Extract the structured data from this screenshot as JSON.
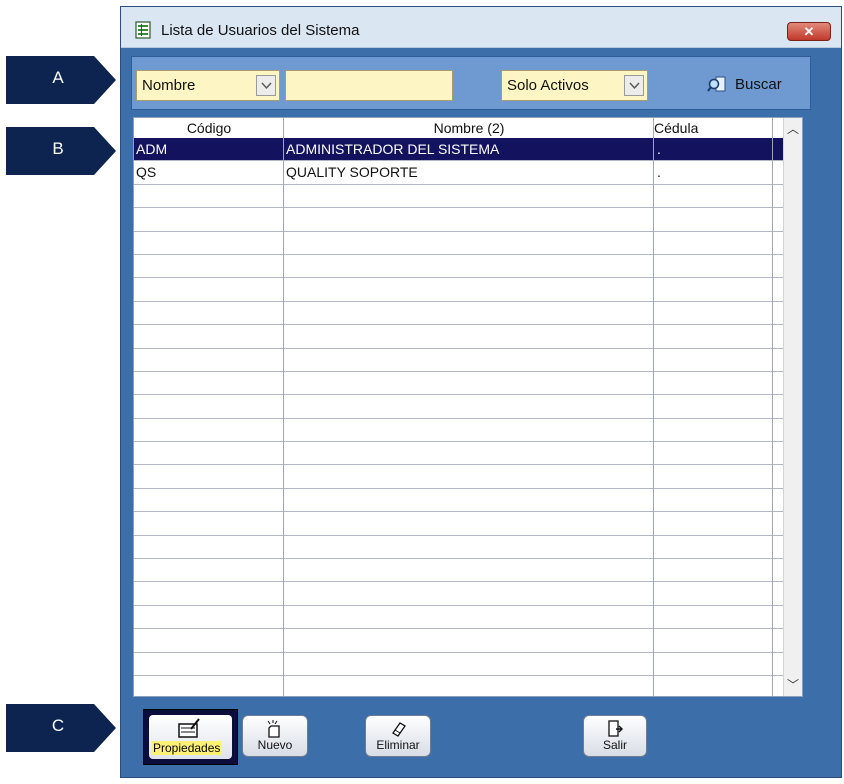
{
  "window": {
    "title": "Lista de Usuarios del Sistema",
    "close_label": "✕",
    "title_icon": "document-grid-icon"
  },
  "filter": {
    "field_select": "Nombre",
    "search_value": "",
    "status_select": "Solo Activos",
    "search_button": "Buscar",
    "search_icon": "magnifier-icon"
  },
  "grid": {
    "columns": [
      "Código",
      "Nombre (2)",
      "Cédula"
    ],
    "rows": [
      {
        "codigo": "ADM",
        "nombre": "ADMINISTRADOR DEL SISTEMA",
        "cedula": ".",
        "selected": true
      },
      {
        "codigo": "QS",
        "nombre": "QUALITY SOPORTE",
        "cedula": ".",
        "selected": false
      }
    ]
  },
  "buttons": {
    "properties": "Propiedades",
    "new": "Nuevo",
    "delete": "Eliminar",
    "exit": "Salir"
  },
  "callouts": [
    "A",
    "B",
    "C"
  ],
  "colors": {
    "window_bg": "#3c6ea9",
    "filterbar_bg": "#6f9ad1",
    "input_bg": "#fdf6c4",
    "selected_row": "#12125e",
    "callout": "#0d2450"
  }
}
